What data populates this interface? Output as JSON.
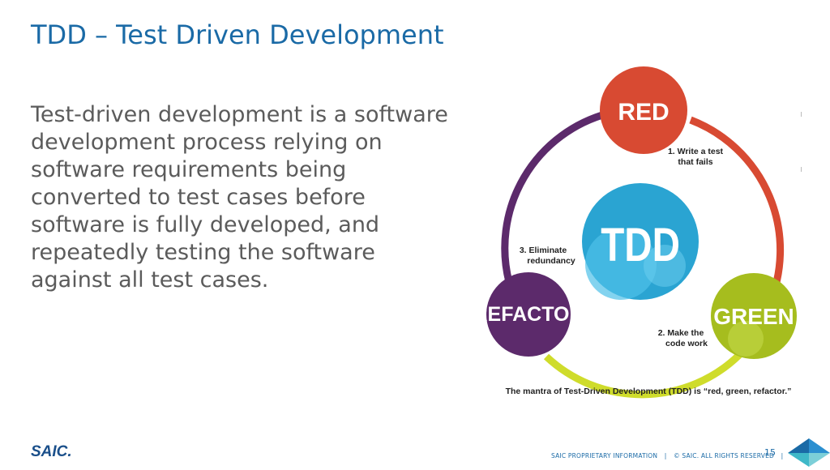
{
  "slide": {
    "title": "TDD – Test Driven Development",
    "body": "Test-driven development is a software development process relying on software requirements being converted to test cases before software is fully developed, and repeatedly testing the software against all test cases."
  },
  "diagram": {
    "center_label": "TDD",
    "nodes": {
      "red": "RED",
      "green": "GREEN",
      "refactor": "REFACTOR"
    },
    "steps": {
      "step1_line1": "1. Write a test",
      "step1_line2": "that fails",
      "step2_line1": "2. Make the",
      "step2_line2": "code work",
      "step3_line1": "3. Eliminate",
      "step3_line2": "redundancy"
    },
    "caption": "The mantra of Test-Driven Development (TDD) is “red, green, refactor.”",
    "colors": {
      "red": "#d84a32",
      "green": "#a6bd1e",
      "purple": "#5c2a6b",
      "center_blue": "#2aa4d2",
      "arc_red": "#d84a32",
      "arc_yellow": "#cfdc2b",
      "arc_purple": "#5c2a6b"
    }
  },
  "footer": {
    "logo": "SAIC.",
    "proprietary": "SAIC PROPRIETARY INFORMATION",
    "copyright": "© SAIC. ALL RIGHTS RESERVED",
    "separator": "|",
    "page_number": "15"
  }
}
